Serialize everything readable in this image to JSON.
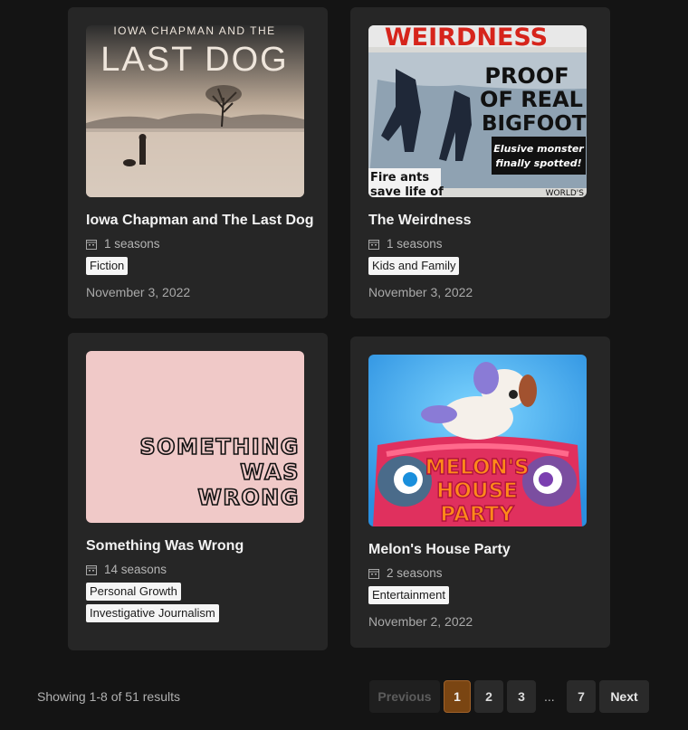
{
  "cards": [
    {
      "title": "Iowa Chapman and The Last Dog",
      "seasons": "1 seasons",
      "tags": [
        "Fiction"
      ],
      "date": "November 3, 2022",
      "cover": {
        "line1": "IOWA CHAPMAN AND THE",
        "line2": "LAST DOG"
      }
    },
    {
      "title": "The Weirdness",
      "seasons": "1 seasons",
      "tags": [
        "Kids and Family"
      ],
      "date": "November 3, 2022",
      "cover": {
        "masthead": "WEIRDNESS",
        "headline1": "PROOF",
        "headline2": "OF REAL",
        "headline3": "BIGFOOT!",
        "sub1": "Elusive monster",
        "sub2": "finally spotted!",
        "side1": "Fire ants",
        "side2": "save life of",
        "footer": "WORLD'S"
      }
    },
    {
      "title": "Something Was Wrong",
      "seasons": "14 seasons",
      "tags": [
        "Personal Growth",
        "Investigative Journalism"
      ],
      "date": "",
      "cover": {
        "line1": "SOMETHING",
        "line2": "WAS",
        "line3": "WRONG"
      }
    },
    {
      "title": "Melon's House Party",
      "seasons": "2 seasons",
      "tags": [
        "Entertainment"
      ],
      "date": "November 2, 2022",
      "cover": {
        "line1": "MELON'S",
        "line2": "HOUSE",
        "line3": "PARTY"
      }
    }
  ],
  "pagination": {
    "summary": "Showing 1-8 of 51 results",
    "previous": "Previous",
    "pages": [
      "1",
      "2",
      "3",
      "7"
    ],
    "ellipsis": "...",
    "next": "Next",
    "current": "1"
  },
  "colors": {
    "background": "#141414",
    "card": "#262626",
    "accent": "#7a4512",
    "tag_bg": "#f5f5f5"
  },
  "icons": {
    "seasons": "calendar-icon"
  }
}
